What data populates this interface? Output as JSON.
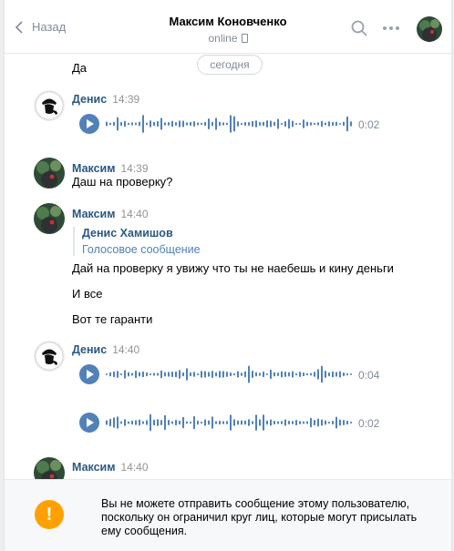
{
  "header": {
    "back_label": "Назад",
    "title": "Максим Коновченко",
    "status": "online"
  },
  "date_separator": "сегодня",
  "messages": [
    {
      "kind": "text-continuation",
      "text": "Да"
    },
    {
      "kind": "voice",
      "author": "Денис",
      "time": "14:39",
      "duration": "0:02"
    },
    {
      "kind": "text",
      "author": "Максим",
      "time": "14:39",
      "text": "Даш на проверку?"
    },
    {
      "kind": "forward-with-text",
      "author": "Максим",
      "time": "14:40",
      "forward_author": "Денис Хамишов",
      "forward_subtitle": "Голосовое сообщение",
      "lines": [
        "Дай на проверку я увижу что ты не наебешь и кину деньги",
        "И все",
        "Вот те гаранти"
      ]
    },
    {
      "kind": "voice",
      "author": "Денис",
      "time": "14:40",
      "duration": "0:04"
    },
    {
      "kind": "voice-continuation",
      "duration": "0:02"
    },
    {
      "kind": "partial",
      "author": "Максим",
      "time": "14:40"
    }
  ],
  "notice": {
    "text": "Вы не можете отправить сообщение этому пользователю, поскольку он ограничил круг лиц, которые могут присылать ему сообщения.",
    "icon": "warning-icon"
  },
  "colors": {
    "accent": "#5181b8",
    "author": "#2a5885",
    "muted": "#828a99",
    "warning": "#ffa000"
  }
}
